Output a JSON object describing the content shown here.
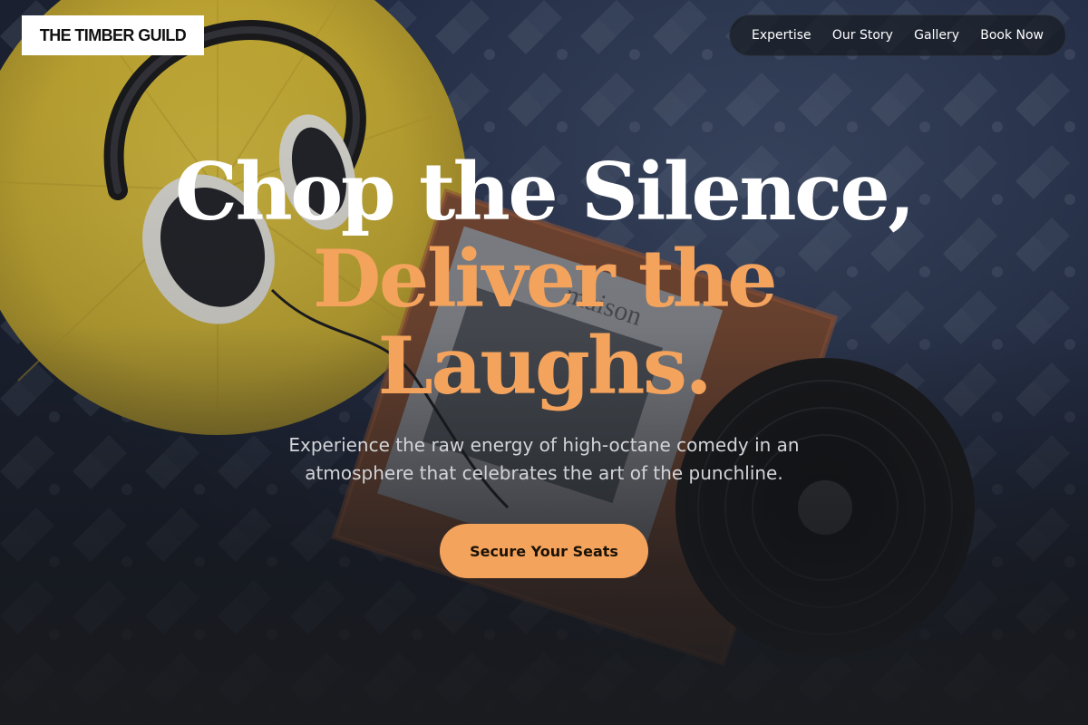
{
  "brand": {
    "name": "THE TIMBER GUILD"
  },
  "nav": {
    "items": [
      {
        "label": "Expertise"
      },
      {
        "label": "Our Story"
      },
      {
        "label": "Gallery"
      },
      {
        "label": "Book Now"
      }
    ]
  },
  "hero": {
    "headline_line1": "Chop the Silence,",
    "headline_line2": "Deliver the",
    "headline_line3": "Laughs.",
    "subtitle_line1": "Experience the raw energy of high-octane comedy in an",
    "subtitle_line2": "atmosphere that celebrates the art of the punchline.",
    "cta_label": "Secure Your Seats"
  },
  "colors": {
    "accent": "#f4a35d",
    "headline_white": "#ffffff",
    "subtitle": "#d2d4d8",
    "nav_bg": "#161a21"
  },
  "background": {
    "photo_subject": "headphones on yellow cushion with vinyl record and book on patterned rug",
    "cushion_icon": "cushion-icon",
    "headphones_icon": "headphones-icon",
    "vinyl_icon": "vinyl-record-icon",
    "book_icon": "book-icon",
    "book_text": "maison"
  }
}
